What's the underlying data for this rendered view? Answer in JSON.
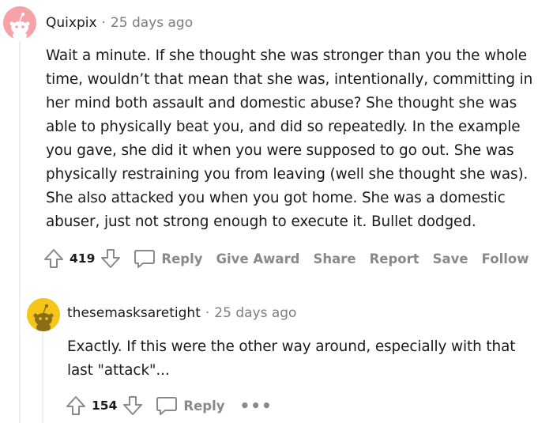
{
  "comments": [
    {
      "username": "Quixpix",
      "separator": "·",
      "time": "25 days ago",
      "body_lines": [
        "Wait a minute. If she thought she was stronger than you the whole",
        "time, wouldn’t that mean that she was, intentionally, committing in",
        "her mind both assault and domestic abuse? She thought she was",
        "able to physically beat you, and did so repeatedly. In the example",
        "you gave, she did it when you were supposed to go out. She was",
        "physically restraining you from leaving (well she thought she was).",
        "She also attacked you when you got home. She was a domestic",
        "abuser, just not strong enough to execute it. Bullet dodged."
      ],
      "score": "419",
      "actions": {
        "reply": "Reply",
        "give_award": "Give Award",
        "share": "Share",
        "report": "Report",
        "save": "Save",
        "follow": "Follow"
      },
      "avatar_color": "#f7a1a9"
    },
    {
      "username": "thesemasksaretight",
      "separator": "·",
      "time": "25 days ago",
      "body_lines": [
        "Exactly. If this were the other way around, especially with that",
        "last \"attack\"..."
      ],
      "score": "154",
      "actions": {
        "reply": "Reply",
        "more": "•••"
      },
      "avatar_color": "#f5c518"
    }
  ],
  "icons": {
    "upvote": "upvote-arrow-icon",
    "downvote": "downvote-arrow-icon",
    "reply": "speech-bubble-icon",
    "avatar": "snoo-avatar-icon",
    "more": "more-options-icon"
  }
}
